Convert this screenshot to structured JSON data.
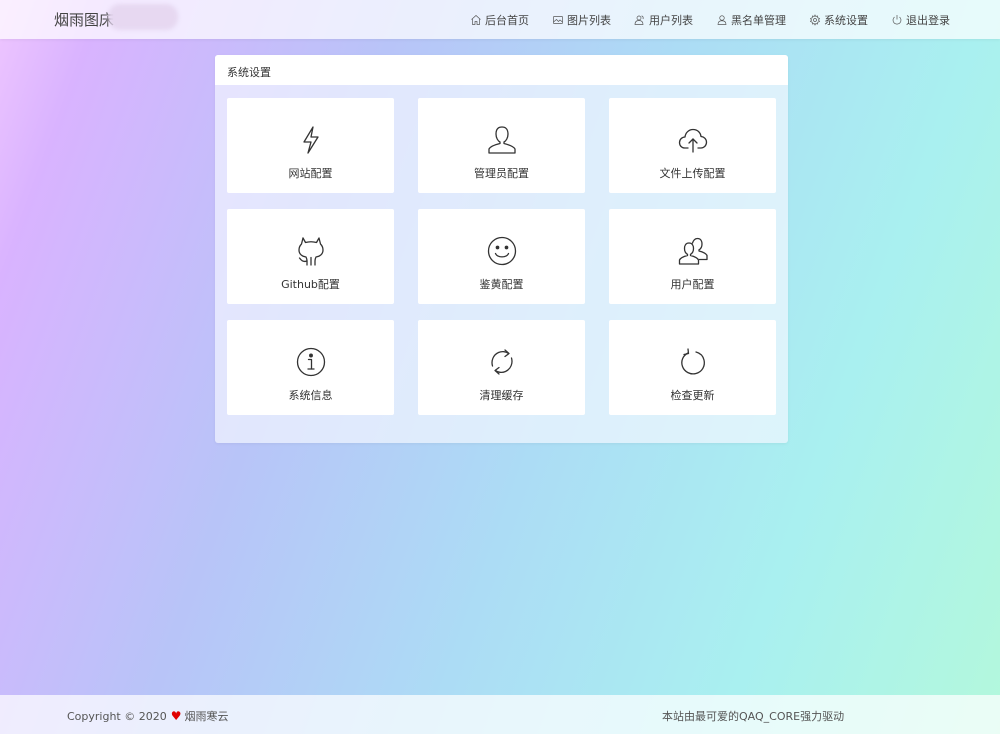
{
  "header": {
    "brand": "烟雨图床",
    "nav": [
      {
        "label": "后台首页",
        "icon": "home-icon"
      },
      {
        "label": "图片列表",
        "icon": "image-icon"
      },
      {
        "label": "用户列表",
        "icon": "users-icon"
      },
      {
        "label": "黑名单管理",
        "icon": "user-icon"
      },
      {
        "label": "系统设置",
        "icon": "gear-icon"
      },
      {
        "label": "退出登录",
        "icon": "power-icon"
      }
    ]
  },
  "panel": {
    "title": "系统设置",
    "cards": [
      {
        "label": "网站配置",
        "icon": "lightning-icon"
      },
      {
        "label": "管理员配置",
        "icon": "user-icon"
      },
      {
        "label": "文件上传配置",
        "icon": "cloud-upload-icon"
      },
      {
        "label": "Github配置",
        "icon": "github-icon"
      },
      {
        "label": "鉴黄配置",
        "icon": "smile-icon"
      },
      {
        "label": "用户配置",
        "icon": "users-icon"
      },
      {
        "label": "系统信息",
        "icon": "info-icon"
      },
      {
        "label": "清理缓存",
        "icon": "refresh-icon"
      },
      {
        "label": "检查更新",
        "icon": "update-icon"
      }
    ]
  },
  "footer": {
    "copyright": "Copyright © 2020",
    "heart": "♥",
    "author": "烟雨寒云",
    "powered_by": "本站由最可爱的QAQ_CORE强力驱动"
  },
  "colors": {
    "heart": "#e00000",
    "text": "#333333"
  }
}
